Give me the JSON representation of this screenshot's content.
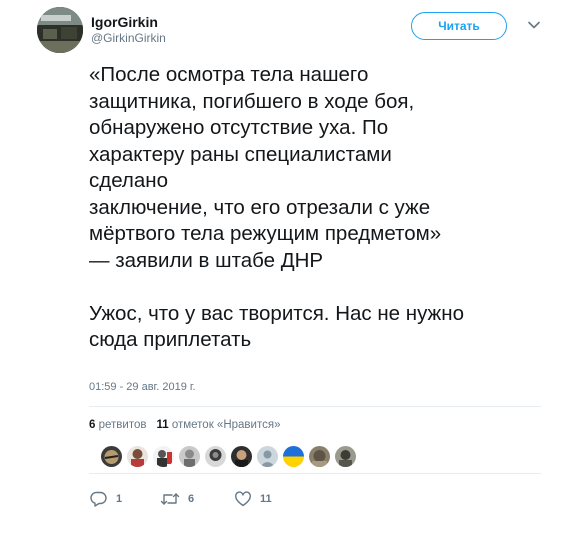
{
  "author": {
    "name": "IgorGirkin",
    "handle": "@GirkinGirkin",
    "avatar_icon": "profile-photo"
  },
  "follow_label": "Читать",
  "tweet": {
    "lines": [
      "«После осмотра тела нашего",
      "защитника, погибшего в ходе боя,",
      "обнаружено отсутствие уха. По",
      "характеру раны специалистами",
      "сделано",
      "заключение, что его отрезали с уже",
      "мёртвого тела режущим предметом»",
      "— заявили в штабе ДНР",
      "Ужос, что у вас творится. Нас не нужно",
      "сюда приплетать"
    ],
    "timestamp": "01:59 - 29 авг. 2019 г."
  },
  "stats": {
    "retweets_count": "6",
    "retweets_label": "ретвитов",
    "likes_count": "11",
    "likes_label": "отметок «Нравится»"
  },
  "actions": {
    "reply_count": "1",
    "retweet_count": "6",
    "like_count": "11"
  },
  "colors": {
    "accent": "#1da1f2",
    "text": "#14171a",
    "secondary": "#657786",
    "divider": "#e6ecf0"
  }
}
